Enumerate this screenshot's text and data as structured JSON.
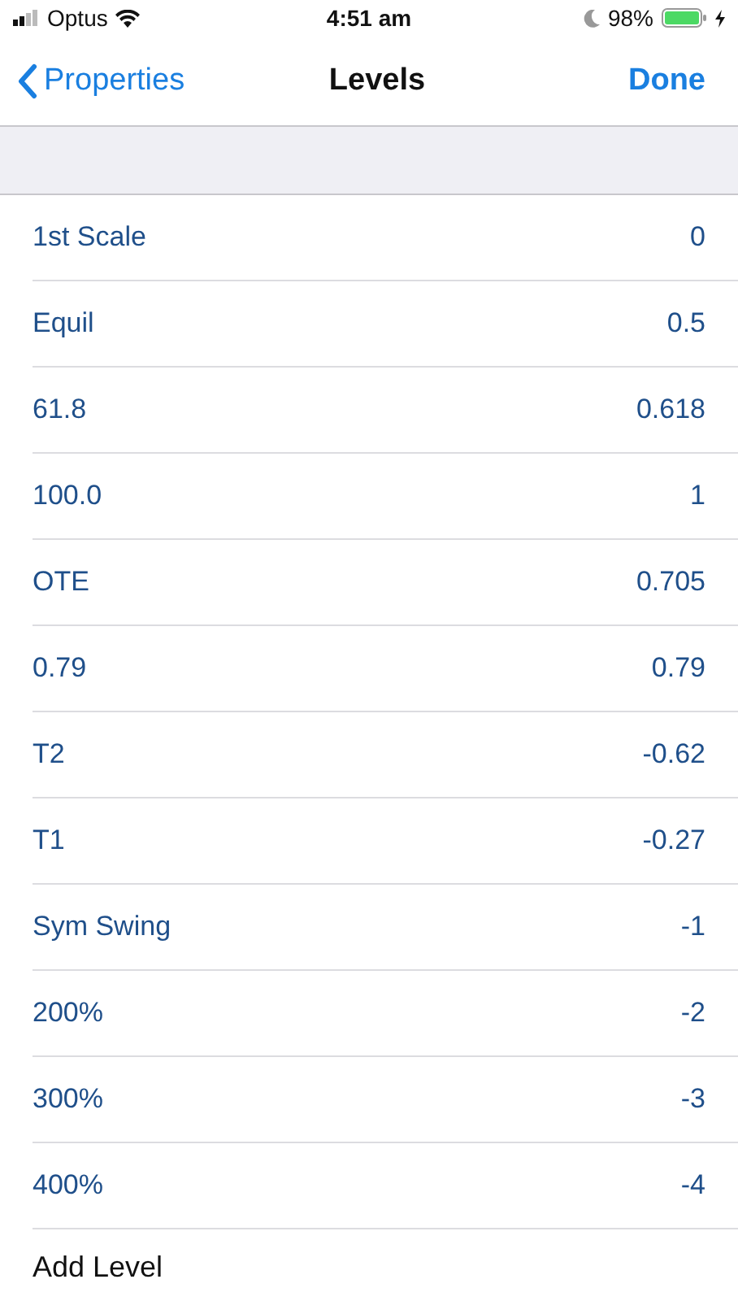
{
  "status_bar": {
    "carrier": "Optus",
    "time": "4:51 am",
    "battery": "98%"
  },
  "nav_bar": {
    "back": "Properties",
    "title": "Levels",
    "action": "Done"
  },
  "levels": [
    {
      "name": "1st Scale",
      "value": "0"
    },
    {
      "name": "Equil",
      "value": "0.5"
    },
    {
      "name": "61.8",
      "value": "0.618"
    },
    {
      "name": "100.0",
      "value": "1"
    },
    {
      "name": "OTE",
      "value": "0.705"
    },
    {
      "name": "0.79",
      "value": "0.79"
    },
    {
      "name": "T2",
      "value": "-0.62"
    },
    {
      "name": "T1",
      "value": "-0.27"
    },
    {
      "name": "Sym Swing",
      "value": "-1"
    },
    {
      "name": "200%",
      "value": "-2"
    },
    {
      "name": "300%",
      "value": "-3"
    },
    {
      "name": "400%",
      "value": "-4"
    }
  ],
  "add_button": "Add Level"
}
